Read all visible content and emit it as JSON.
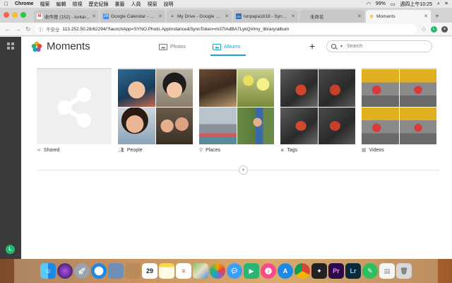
{
  "menubar": {
    "apple": "",
    "app": "Chrome",
    "items": [
      "檔案",
      "編輯",
      "檢視",
      "歷史紀錄",
      "書籤",
      "人員",
      "視窗",
      "說明"
    ],
    "battery": "99%",
    "clock": "週四上午10:25"
  },
  "tabs": [
    {
      "title": "收件匣 (152) - luntar...",
      "fav": "M",
      "color": "#d93025",
      "active": false
    },
    {
      "title": "Google Calendar - Da...",
      "fav": "28",
      "color": "#4285f4",
      "active": false
    },
    {
      "title": "My Drive - Google Dr...",
      "fav": "▲",
      "color": "#1fa463",
      "active": false
    },
    {
      "title": "lunpapa1618 - Synolo...",
      "fav": "DS",
      "color": "#2b6fb6",
      "active": false
    },
    {
      "title": "未命名",
      "fav": "◌",
      "color": "#999999",
      "active": false
    },
    {
      "title": "Moments",
      "fav": "✿",
      "color": "#f2a900",
      "active": true
    }
  ],
  "address": {
    "unsafe": "不安全",
    "url": "113.252.50.28/62294/?launchApp=SYNO.Photo.AppInstance&SynoToken=m37IAdBA7LykQ#/my_library/album"
  },
  "rail": {
    "user_initial": "L"
  },
  "app": {
    "title": "Moments",
    "nav_photos": "Photos",
    "nav_albums": "Albums",
    "search_placeholder": "Search",
    "accent": "#1aa5c6"
  },
  "albums": [
    {
      "label": "Shared",
      "icon": "share-icon"
    },
    {
      "label": "People",
      "icon": "people-icon"
    },
    {
      "label": "Places",
      "icon": "pin-icon"
    },
    {
      "label": "Tags",
      "icon": "tag-icon"
    },
    {
      "label": "Videos",
      "icon": "film-icon"
    }
  ],
  "dock": {
    "calendar_day": "29"
  }
}
